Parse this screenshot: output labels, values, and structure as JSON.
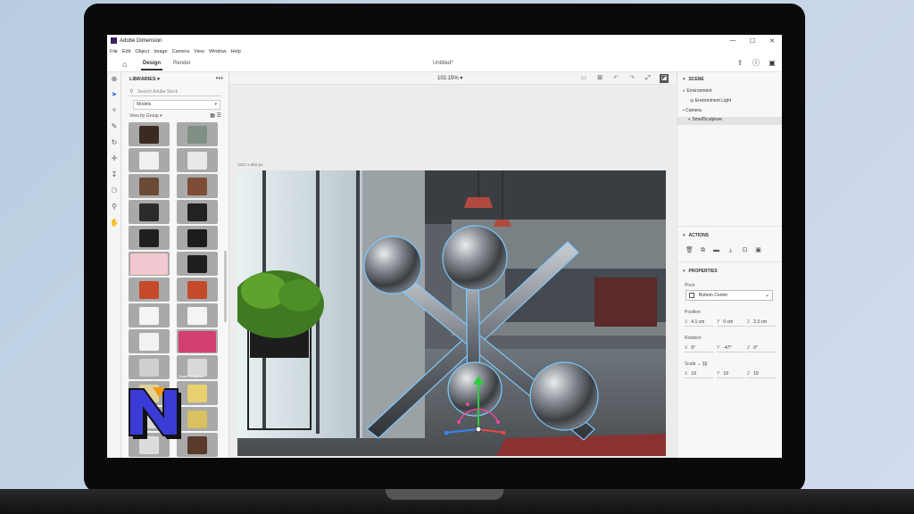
{
  "window": {
    "app_title": "Adobe Dimension",
    "controls": [
      "—",
      "☐",
      "✕"
    ]
  },
  "menu": [
    "File",
    "Edit",
    "Object",
    "Image",
    "Camera",
    "View",
    "Window",
    "Help"
  ],
  "tabs": {
    "design": "Design",
    "render": "Render"
  },
  "document_title": "Untitled*",
  "libraries": {
    "header": "LIBRARIES",
    "more": "•••",
    "search_placeholder": "Search Adobe Stock",
    "filter_value": "Models",
    "view_by": "View by Group",
    "assets": [
      {
        "label": "",
        "color": "#3a2a22"
      },
      {
        "label": "",
        "color": "#7f8f84"
      },
      {
        "label": "",
        "color": "#f1f1f1"
      },
      {
        "label": "",
        "color": "#e8e8e8"
      },
      {
        "label": "",
        "color": "#6b4a36"
      },
      {
        "label": "",
        "color": "#7c4c36"
      },
      {
        "label": "",
        "color": "#2b2b2b"
      },
      {
        "label": "",
        "color": "#222222"
      },
      {
        "label": "",
        "color": "#1f1f1f"
      },
      {
        "label": "",
        "color": "#1c1c1c"
      },
      {
        "label": "",
        "color": "#f3c7cf"
      },
      {
        "label": "",
        "color": "#1e1e1e"
      },
      {
        "label": "",
        "color": "#c44a2a"
      },
      {
        "label": "",
        "color": "#c44a2a"
      },
      {
        "label": "",
        "color": "#f4f4f4"
      },
      {
        "label": "",
        "color": "#f4f4f4"
      },
      {
        "label": "",
        "color": "#f2f2f2"
      },
      {
        "label": "",
        "color": "#d24070"
      },
      {
        "label": "",
        "color": "#cfcfcf"
      },
      {
        "label": "Small Sculpture",
        "color": "#d9d9d9"
      },
      {
        "label": "",
        "color": "#e0d39a"
      },
      {
        "label": "",
        "color": "#e8d070"
      },
      {
        "label": "",
        "color": "#d8d8d8"
      },
      {
        "label": "",
        "color": "#d9c060"
      },
      {
        "label": "",
        "color": "#dcdcdc"
      },
      {
        "label": "",
        "color": "#5a3a2a"
      }
    ]
  },
  "canvas": {
    "zoom": "102.15%",
    "dimensions": "1024 x 682 px"
  },
  "scene": {
    "header": "SCENE",
    "items": [
      "Environment",
      "Environment Light",
      "Camera",
      "SmallSculpture"
    ]
  },
  "actions": {
    "header": "ACTIONS"
  },
  "properties": {
    "header": "PROPERTIES",
    "pivot_label": "Pivot",
    "pivot_value": "Bottom Center",
    "position_label": "Position",
    "position": {
      "x": "4.1 cm",
      "y": "0 cm",
      "z": "2.3 cm"
    },
    "rotation_label": "Rotation",
    "rotation": {
      "x": "0°",
      "y": "-47°",
      "z": "0°"
    },
    "scale_label": "Scale",
    "scale": {
      "x": "19",
      "y": "19",
      "z": "19"
    }
  },
  "colors": {
    "accent_logo": "#3b3bd6",
    "selection_outline": "#7ec8ff",
    "floor_mat": "#8a3232"
  }
}
